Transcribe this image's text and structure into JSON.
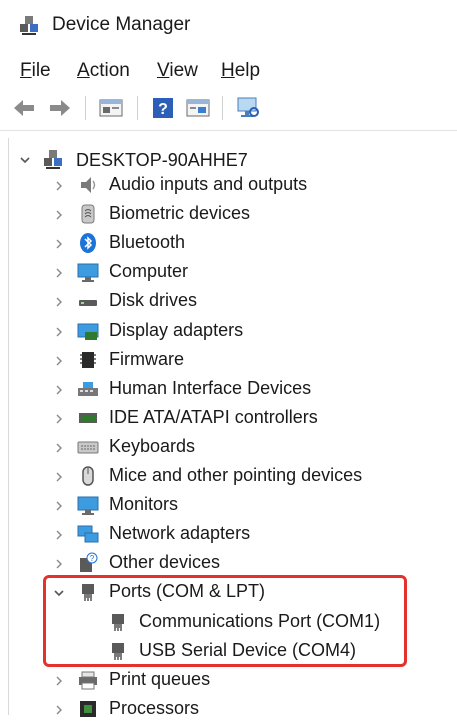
{
  "window": {
    "title": "Device Manager"
  },
  "menu": {
    "items": [
      {
        "label": "File",
        "mnemonic": "F",
        "rest": "ile"
      },
      {
        "label": "Action",
        "mnemonic": "A",
        "rest": "ction"
      },
      {
        "label": "View",
        "mnemonic": "V",
        "rest": "iew"
      },
      {
        "label": "Help",
        "mnemonic": "H",
        "rest": "elp"
      }
    ]
  },
  "toolbar": {
    "buttons": [
      "back-icon",
      "forward-icon",
      "properties-icon",
      "help-icon",
      "driver-icon",
      "scan-hardware-icon"
    ]
  },
  "tree": {
    "root": "DESKTOP-90AHHE7",
    "categories": [
      {
        "label": "Audio inputs and outputs",
        "icon": "speaker-icon"
      },
      {
        "label": "Biometric devices",
        "icon": "fingerprint-icon"
      },
      {
        "label": "Bluetooth",
        "icon": "bluetooth-icon"
      },
      {
        "label": "Computer",
        "icon": "monitor-icon"
      },
      {
        "label": "Disk drives",
        "icon": "disk-drive-icon"
      },
      {
        "label": "Display adapters",
        "icon": "display-adapter-icon"
      },
      {
        "label": "Firmware",
        "icon": "chip-icon"
      },
      {
        "label": "Human Interface Devices",
        "icon": "hid-icon"
      },
      {
        "label": "IDE ATA/ATAPI controllers",
        "icon": "ide-controller-icon"
      },
      {
        "label": "Keyboards",
        "icon": "keyboard-icon"
      },
      {
        "label": "Mice and other pointing devices",
        "icon": "mouse-icon"
      },
      {
        "label": "Monitors",
        "icon": "monitor-icon"
      },
      {
        "label": "Network adapters",
        "icon": "network-icon"
      },
      {
        "label": "Other devices",
        "icon": "unknown-device-icon"
      },
      {
        "label": "Ports (COM & LPT)",
        "icon": "port-icon",
        "expanded": true,
        "children": [
          {
            "label": "Communications Port (COM1)",
            "icon": "port-icon"
          },
          {
            "label": "USB Serial Device (COM4)",
            "icon": "port-icon"
          }
        ]
      },
      {
        "label": "Print queues",
        "icon": "printer-icon"
      },
      {
        "label": "Processors",
        "icon": "processor-icon"
      }
    ]
  },
  "colors": {
    "highlight": "#e4312b",
    "accent": "#1e73d8"
  }
}
